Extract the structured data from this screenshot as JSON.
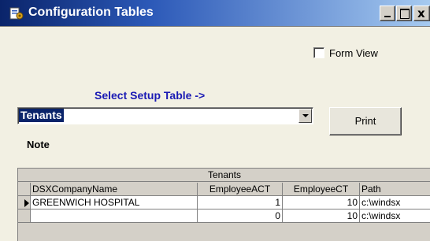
{
  "window": {
    "title": "Configuration Tables",
    "close_glyph": "x"
  },
  "form_view": {
    "label": "Form View",
    "checked": false
  },
  "select_setup": {
    "label": "Select Setup Table ->",
    "value": "Tenants"
  },
  "print_label": "Print",
  "note_label": "Note",
  "grid": {
    "caption": "Tenants",
    "columns": [
      "DSXCompanyName",
      "EmployeeACT",
      "EmployeeCT",
      "Path"
    ],
    "rows": [
      [
        "GREENWICH HOSPITAL",
        "1",
        "10",
        "c:\\windsx"
      ],
      [
        "",
        "0",
        "10",
        "c:\\windsx"
      ]
    ]
  },
  "colors": {
    "title_bar": "#0a246a",
    "accent_label": "#1a1ab4",
    "background": "#f2f0e3"
  },
  "icons": [
    "app-icon",
    "minimize-icon",
    "maximize-icon",
    "close-icon",
    "dropdown-arrow-icon",
    "row-pointer-icon"
  ]
}
